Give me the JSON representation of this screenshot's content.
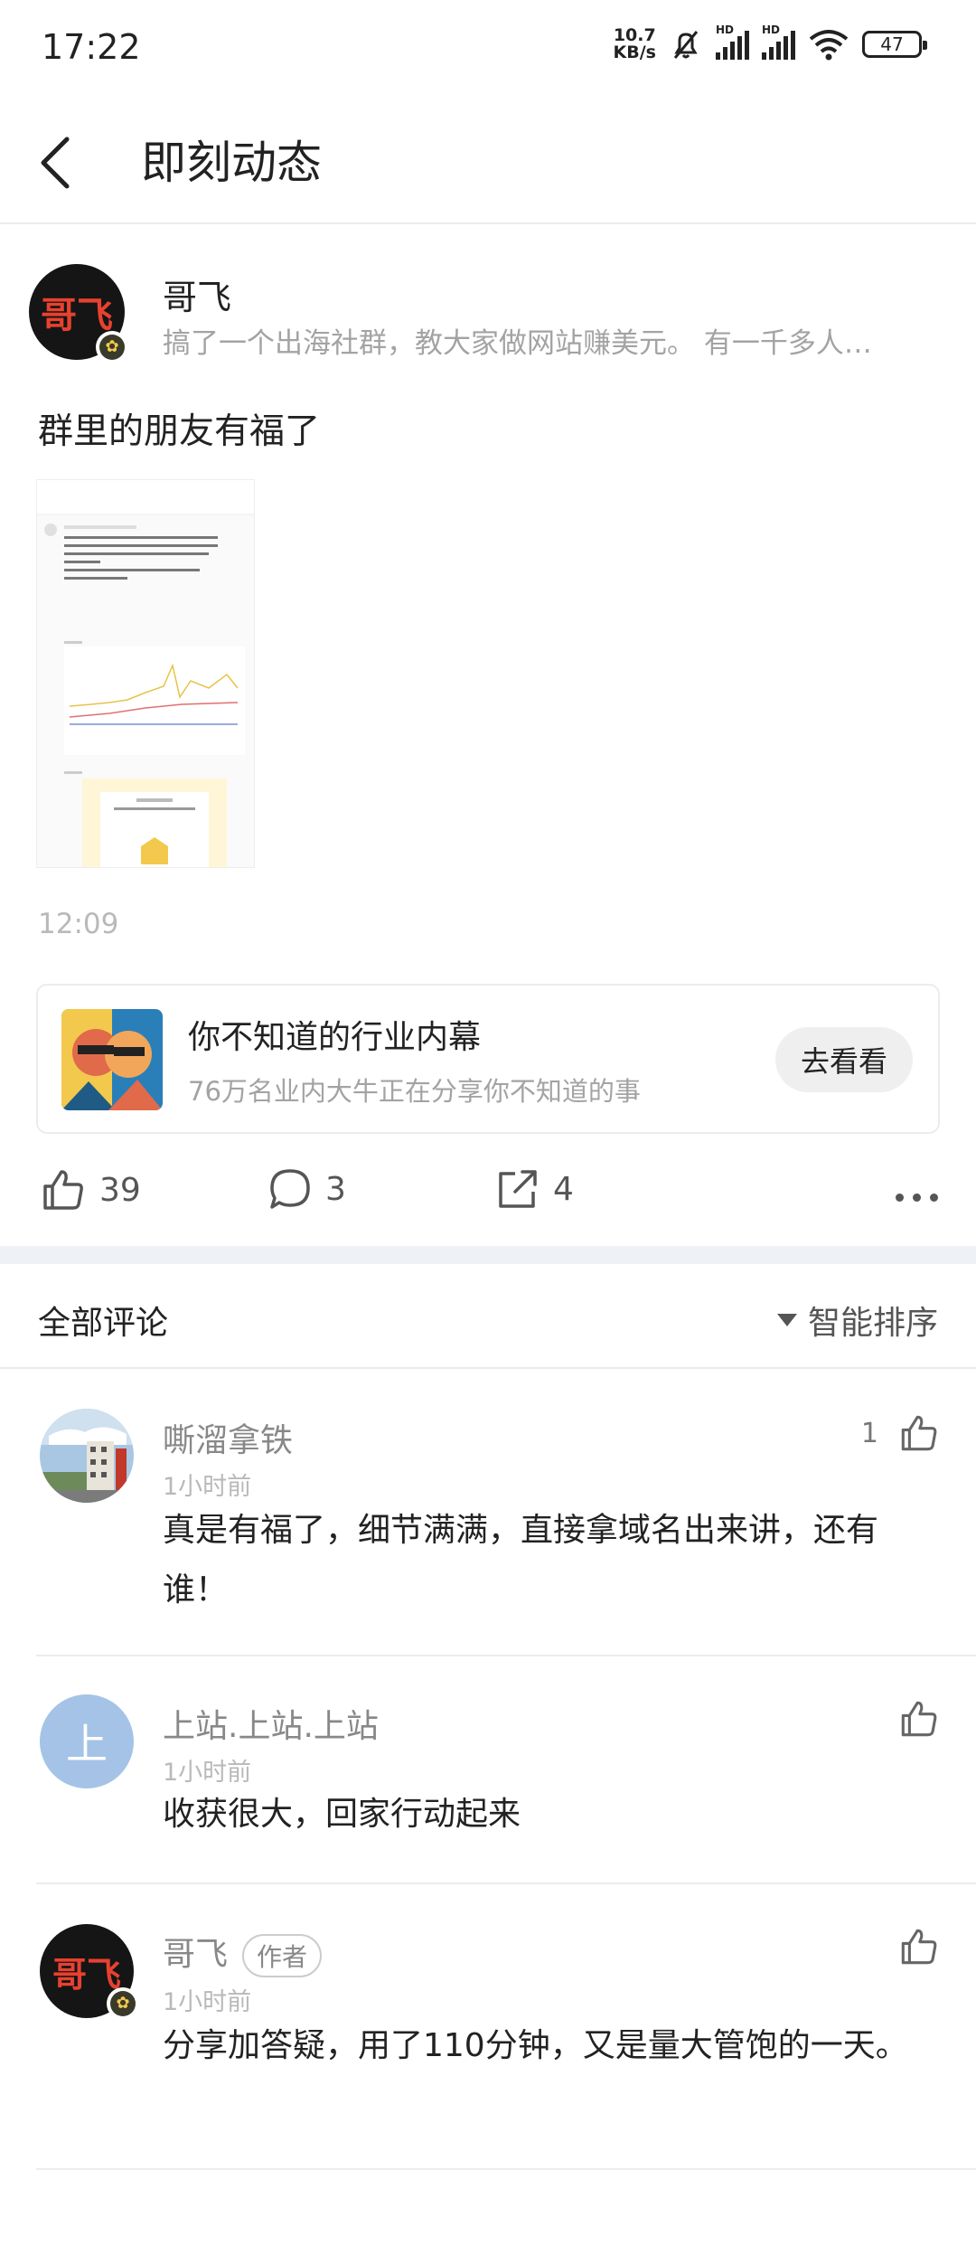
{
  "status_bar": {
    "time": "17:22",
    "net_speed_value": "10.7",
    "net_speed_unit": "KB/s",
    "sim1_label": "HD",
    "sim2_label": "HD",
    "battery": "47"
  },
  "header": {
    "title": "即刻动态"
  },
  "post": {
    "author_name": "哥飞",
    "avatar_text": "哥飞",
    "author_desc": "搞了一个出海社群，教大家做网站赚美元。 有一千多人…",
    "text": "群里的朋友有福了",
    "time": "12:09"
  },
  "promo": {
    "title": "你不知道的行业内幕",
    "subtitle": "76万名业内大牛正在分享你不知道的事",
    "button_label": "去看看"
  },
  "actions": {
    "likes": "39",
    "comments": "3",
    "shares": "4"
  },
  "comments_header": {
    "title": "全部评论",
    "sort_label": "智能排序"
  },
  "comments": [
    {
      "name": "嘶溜拿铁",
      "time": "1小时前",
      "text": "真是有福了，细节满满，直接拿域名出来讲，还有谁！",
      "likes": "1"
    },
    {
      "name": "上站.上站.上站",
      "avatar_text": "上",
      "time": "1小时前",
      "text": "收获很大，回家行动起来",
      "likes": ""
    },
    {
      "name": "哥飞",
      "avatar_text": "哥飞",
      "tag": "作者",
      "time": "1小时前",
      "text": "分享加答疑，用了110分钟，又是量大管饱的一天。",
      "likes": ""
    }
  ]
}
